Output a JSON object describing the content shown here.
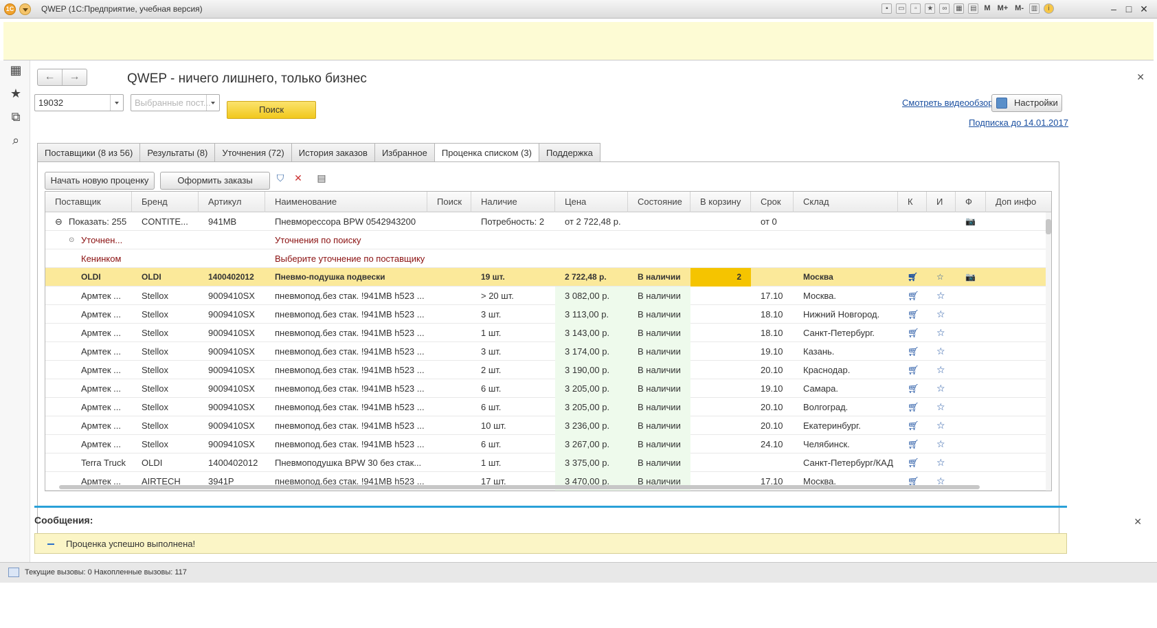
{
  "window": {
    "title": "QWEP  (1С:Предприятие, учебная версия)",
    "toolbar_m": [
      "M",
      "M+",
      "M-"
    ]
  },
  "form": {
    "title": "QWEP - ничего лишнего, только бизнес",
    "search_value": "19032",
    "supplier_placeholder": "Выбранные пост...",
    "search_button": "Поиск",
    "video_link": "Смотреть видеообзор",
    "settings_button": "Настройки",
    "subscription_link": "Подписка до 14.01.2017"
  },
  "tabs": [
    "Поставщики (8 из 56)",
    "Результаты (8)",
    "Уточнения (72)",
    "История заказов",
    "Избранное",
    "Проценка  списком (3)",
    "Поддержка"
  ],
  "toolbar": {
    "new_pricing": "Начать новую проценку",
    "make_orders": "Оформить заказы"
  },
  "grid": {
    "columns": [
      "Поставщик",
      "Бренд",
      "Артикул",
      "Наименование",
      "Поиск",
      "Наличие",
      "Цена",
      "Состояние",
      "В корзину",
      "Срок",
      "Склад",
      "К",
      "И",
      "Ф",
      "Доп инфо"
    ],
    "group_row": {
      "supplier": "Показать: 255",
      "brand": "CONTITE...",
      "article": "941MB",
      "name": "Пневморессора BPW 0542943200",
      "stock": "Потребность: 2",
      "price": "от 2 722,48 р.",
      "term": "от 0"
    },
    "refine_row": {
      "supplier": "Уточнен...",
      "name": "Уточнения по поиску"
    },
    "keninkom_row": {
      "supplier": "Кенинком",
      "name": "Выберите уточнение по поставщику"
    },
    "selected_row": {
      "supplier": "OLDI",
      "brand": "OLDI",
      "article": "1400402012",
      "name": "Пневмо-подушка подвески",
      "stock": "19 шт.",
      "price": "2 722,48 р.",
      "state": "В наличии",
      "cart": "2",
      "warehouse": "Москва"
    },
    "rows": [
      {
        "supplier": "Армтек ...",
        "brand": "Stellox",
        "article": "9009410SX",
        "name": "пневмопод.без стак. !941MB h523 ...",
        "stock": "> 20 шт.",
        "price": "3 082,00 р.",
        "state": "В наличии",
        "term": "17.10",
        "warehouse": "Москва."
      },
      {
        "supplier": "Армтек ...",
        "brand": "Stellox",
        "article": "9009410SX",
        "name": "пневмопод.без стак. !941MB h523 ...",
        "stock": "3 шт.",
        "price": "3 113,00 р.",
        "state": "В наличии",
        "term": "18.10",
        "warehouse": "Нижний Новгород."
      },
      {
        "supplier": "Армтек ...",
        "brand": "Stellox",
        "article": "9009410SX",
        "name": "пневмопод.без стак. !941MB h523 ...",
        "stock": "1 шт.",
        "price": "3 143,00 р.",
        "state": "В наличии",
        "term": "18.10",
        "warehouse": "Санкт-Петербург."
      },
      {
        "supplier": "Армтек ...",
        "brand": "Stellox",
        "article": "9009410SX",
        "name": "пневмопод.без стак. !941MB h523 ...",
        "stock": "3 шт.",
        "price": "3 174,00 р.",
        "state": "В наличии",
        "term": "19.10",
        "warehouse": "Казань."
      },
      {
        "supplier": "Армтек ...",
        "brand": "Stellox",
        "article": "9009410SX",
        "name": "пневмопод.без стак. !941MB h523 ...",
        "stock": "2 шт.",
        "price": "3 190,00 р.",
        "state": "В наличии",
        "term": "20.10",
        "warehouse": "Краснодар."
      },
      {
        "supplier": "Армтек ...",
        "brand": "Stellox",
        "article": "9009410SX",
        "name": "пневмопод.без стак. !941MB h523 ...",
        "stock": "6 шт.",
        "price": "3 205,00 р.",
        "state": "В наличии",
        "term": "19.10",
        "warehouse": "Самара."
      },
      {
        "supplier": "Армтек ...",
        "brand": "Stellox",
        "article": "9009410SX",
        "name": "пневмопод.без стак. !941MB h523 ...",
        "stock": "6 шт.",
        "price": "3 205,00 р.",
        "state": "В наличии",
        "term": "20.10",
        "warehouse": "Волгоград."
      },
      {
        "supplier": "Армтек ...",
        "brand": "Stellox",
        "article": "9009410SX",
        "name": "пневмопод.без стак. !941MB h523 ...",
        "stock": "10 шт.",
        "price": "3 236,00 р.",
        "state": "В наличии",
        "term": "20.10",
        "warehouse": "Екатеринбург."
      },
      {
        "supplier": "Армтек ...",
        "brand": "Stellox",
        "article": "9009410SX",
        "name": "пневмопод.без стак. !941MB h523 ...",
        "stock": "6 шт.",
        "price": "3 267,00 р.",
        "state": "В наличии",
        "term": "24.10",
        "warehouse": "Челябинск."
      },
      {
        "supplier": "Terra Truck",
        "brand": "OLDI",
        "article": "1400402012",
        "name": "Пневмоподушка BPW 30 без стак...",
        "stock": "1 шт.",
        "price": "3 375,00 р.",
        "state": "В наличии",
        "term": "",
        "warehouse": "Санкт-Петербург/КАД"
      },
      {
        "supplier": "Армтек ...",
        "brand": "AIRTECH",
        "article": "3941P",
        "name": "пневмопод.без стак. !941MB h523 ...",
        "stock": "17 шт.",
        "price": "3 470,00 р.",
        "state": "В наличии",
        "term": "17.10",
        "warehouse": "Москва."
      }
    ]
  },
  "messages": {
    "title": "Сообщения:",
    "text": "Проценка успешно выполнена!"
  },
  "status": {
    "text": "Текущие вызовы: 0   Накопленные вызовы: 117"
  },
  "colors": {
    "accent_yellow": "#f1c81c",
    "selected_row": "#fbe99a",
    "link": "#1a4fa0",
    "message_bar": "#2aa0d8",
    "price_bg": "#eefaec"
  },
  "icons": [
    "cart-icon",
    "star-icon",
    "camera-icon",
    "filter-icon",
    "clear-filter-icon",
    "print-icon"
  ]
}
